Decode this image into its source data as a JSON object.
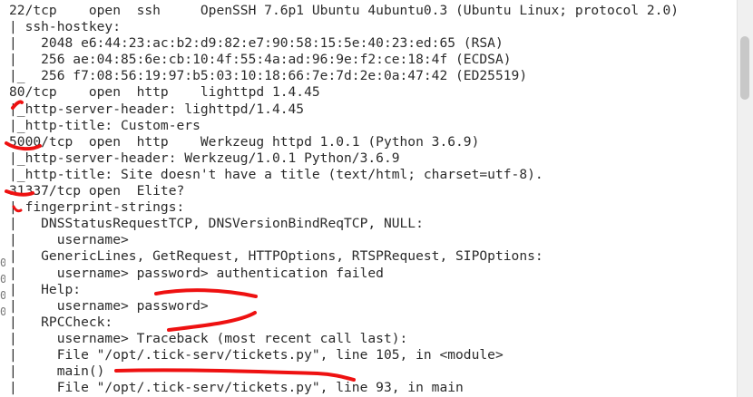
{
  "terminal": {
    "lines": [
      "22/tcp    open  ssh     OpenSSH 7.6p1 Ubuntu 4ubuntu0.3 (Ubuntu Linux; protocol 2.0)",
      "| ssh-hostkey:",
      "|   2048 e6:44:23:ac:b2:d9:82:e7:90:58:15:5e:40:23:ed:65 (RSA)",
      "|   256 ae:04:85:6e:cb:10:4f:55:4a:ad:96:9e:f2:ce:18:4f (ECDSA)",
      "|_  256 f7:08:56:19:97:b5:03:10:18:66:7e:7d:2e:0a:47:42 (ED25519)",
      "80/tcp    open  http    lighttpd 1.4.45",
      "|_http-server-header: lighttpd/1.4.45",
      "|_http-title: Custom-ers",
      "5000/tcp  open  http    Werkzeug httpd 1.0.1 (Python 3.6.9)",
      "|_http-server-header: Werkzeug/1.0.1 Python/3.6.9",
      "|_http-title: Site doesn't have a title (text/html; charset=utf-8).",
      "31337/tcp open  Elite?",
      "| fingerprint-strings:",
      "|   DNSStatusRequestTCP, DNSVersionBindReqTCP, NULL:",
      "|     username>",
      "|   GenericLines, GetRequest, HTTPOptions, RTSPRequest, SIPOptions:",
      "|     username> password> authentication failed",
      "|   Help:",
      "|     username> password>",
      "|   RPCCheck:",
      "|     username> Traceback (most recent call last):",
      "|     File \"/opt/.tick-serv/tickets.py\", line 105, in <module>",
      "|     main()",
      "|     File \"/opt/.tick-serv/tickets.py\", line 93, in main"
    ],
    "gutter_marks": [
      "0",
      "0",
      "0",
      "0"
    ]
  },
  "colors": {
    "text": "#2b2b2b",
    "background": "#ffffff",
    "annotation": "#ee1111"
  }
}
